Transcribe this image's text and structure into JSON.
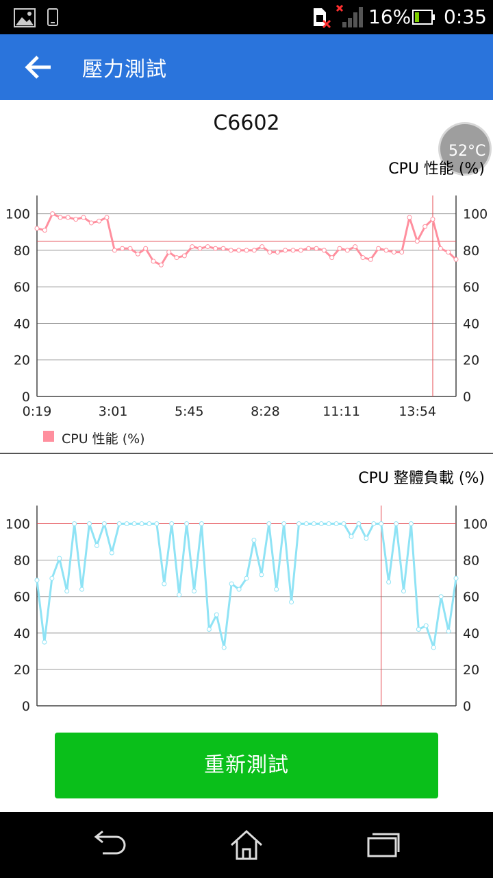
{
  "status_bar": {
    "battery_percent": "16%",
    "time": "0:35",
    "icons": [
      "gallery-icon",
      "phone-icon",
      "sim-error-icon",
      "no-signal-icon",
      "battery-icon"
    ]
  },
  "app_bar": {
    "title": "壓力測試",
    "back_icon": "arrow-left-icon"
  },
  "device": {
    "name": "C6602",
    "temperature": "52°C"
  },
  "charts": {
    "cpu_performance": {
      "title": "CPU 性能 (%)",
      "legend_label": "CPU 性能 (%)",
      "color": "#ff8f9e"
    },
    "cpu_load": {
      "title": "CPU 整體負載 (%)",
      "color": "#8fe3f5"
    }
  },
  "chart_data": [
    {
      "type": "line",
      "title": "CPU 性能 (%)",
      "xlabel": "",
      "ylabel": "",
      "x_tick_labels": [
        "0:19",
        "3:01",
        "5:45",
        "8:28",
        "11:11",
        "13:54"
      ],
      "y_ticks": [
        0,
        20,
        40,
        60,
        80,
        100
      ],
      "ylim": [
        0,
        110
      ],
      "reference_line": 85,
      "marker_x_index": 51,
      "grid": true,
      "legend_position": "bottom-left",
      "series": [
        {
          "name": "CPU 性能 (%)",
          "color": "#ff8f9e",
          "values": [
            92,
            91,
            100,
            98,
            98,
            97,
            98,
            95,
            96,
            98,
            80,
            81,
            81,
            78,
            81,
            74,
            72,
            79,
            76,
            77,
            82,
            81,
            82,
            81,
            81,
            80,
            80,
            80,
            80,
            82,
            79,
            79,
            80,
            80,
            80,
            81,
            81,
            80,
            76,
            81,
            80,
            82,
            76,
            75,
            81,
            80,
            79,
            79,
            98,
            85,
            93,
            97,
            81,
            79,
            75
          ]
        }
      ]
    },
    {
      "type": "line",
      "title": "CPU 整體負載 (%)",
      "xlabel": "",
      "ylabel": "",
      "y_ticks": [
        0,
        20,
        40,
        60,
        80,
        100
      ],
      "ylim": [
        0,
        110
      ],
      "reference_line": 100,
      "marker_x_index": 46,
      "grid": true,
      "series": [
        {
          "name": "CPU 整體負載 (%)",
          "color": "#8fe3f5",
          "values": [
            69,
            35,
            70,
            81,
            63,
            100,
            64,
            100,
            88,
            100,
            84,
            100,
            100,
            100,
            100,
            100,
            100,
            67,
            100,
            61,
            100,
            63,
            100,
            42,
            50,
            32,
            67,
            64,
            70,
            91,
            72,
            100,
            64,
            100,
            57,
            100,
            100,
            100,
            100,
            100,
            100,
            100,
            93,
            100,
            92,
            100,
            100,
            68,
            100,
            63,
            100,
            42,
            44,
            32,
            60,
            41,
            70
          ]
        }
      ]
    }
  ],
  "buttons": {
    "retest": "重新測試"
  },
  "nav_bar": {
    "back": "back-icon",
    "home": "home-icon",
    "recents": "recents-icon"
  }
}
